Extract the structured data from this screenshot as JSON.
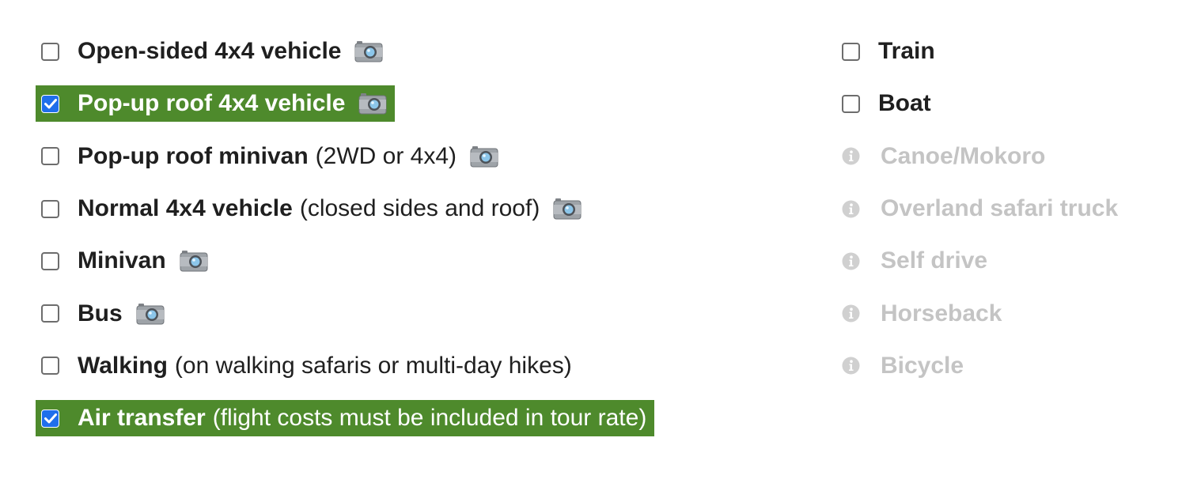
{
  "left_options": [
    {
      "label": "Open-sided 4x4 vehicle",
      "sub": "",
      "checked": false,
      "camera": true
    },
    {
      "label": "Pop-up roof 4x4 vehicle",
      "sub": "",
      "checked": true,
      "camera": true
    },
    {
      "label": "Pop-up roof minivan",
      "sub": "(2WD or 4x4)",
      "checked": false,
      "camera": true
    },
    {
      "label": "Normal 4x4 vehicle",
      "sub": "(closed sides and roof)",
      "checked": false,
      "camera": true
    },
    {
      "label": "Minivan",
      "sub": "",
      "checked": false,
      "camera": true
    },
    {
      "label": "Bus",
      "sub": "",
      "checked": false,
      "camera": true
    },
    {
      "label": "Walking",
      "sub": "(on walking safaris or multi-day hikes)",
      "checked": false,
      "camera": false
    },
    {
      "label": "Air transfer",
      "sub": "(flight costs must be included in tour rate)",
      "checked": true,
      "camera": false
    }
  ],
  "right_options": [
    {
      "label": "Train",
      "checked": false,
      "enabled": true
    },
    {
      "label": "Boat",
      "checked": false,
      "enabled": true
    },
    {
      "label": "Canoe/Mokoro",
      "checked": false,
      "enabled": false
    },
    {
      "label": "Overland safari truck",
      "checked": false,
      "enabled": false
    },
    {
      "label": "Self drive",
      "checked": false,
      "enabled": false
    },
    {
      "label": "Horseback",
      "checked": false,
      "enabled": false
    },
    {
      "label": "Bicycle",
      "checked": false,
      "enabled": false
    }
  ],
  "colors": {
    "checked_background": "#4e8a2c",
    "checkbox_checked": "#1f6feb",
    "disabled_text": "#c4c4c4",
    "info_icon": "#d0d0d0"
  },
  "icons": {
    "photo": "camera-icon",
    "disabled_hint": "info-icon",
    "checked_mark": "checkmark-icon"
  }
}
